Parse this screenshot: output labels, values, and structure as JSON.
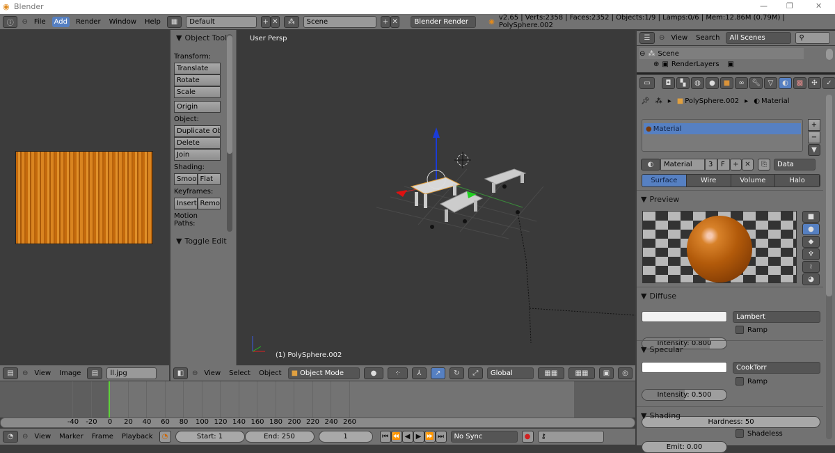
{
  "window": {
    "title": "Blender",
    "controls": [
      "—",
      "❐",
      "✕"
    ]
  },
  "topbar": {
    "menus": [
      "File",
      "Add",
      "Render",
      "Window",
      "Help"
    ],
    "active_menu": "Add",
    "layout": "Default",
    "scene": "Scene",
    "engine": "Blender Render",
    "stats": "v2.65 | Verts:2358 | Faces:2352 | Objects:1/9 | Lamps:0/6 | Mem:12.86M (0.79M) | PolySphere.002"
  },
  "image_editor": {
    "header": {
      "menus": [
        "View",
        "Image"
      ],
      "image": "ll.jpg"
    }
  },
  "tools": {
    "title": "Object Tools",
    "sections": [
      {
        "label": "Transform:",
        "buttons": [
          [
            "Translate"
          ],
          [
            "Rotate"
          ],
          [
            "Scale"
          ]
        ]
      },
      {
        "label": "",
        "buttons": [
          [
            "Origin"
          ]
        ]
      },
      {
        "label": "Object:",
        "buttons": [
          [
            "Duplicate Obj"
          ],
          [
            "Delete"
          ],
          [
            "Join"
          ]
        ]
      },
      {
        "label": "Shading:",
        "buttons": [
          [
            "Smoot",
            "Flat"
          ]
        ]
      },
      {
        "label": "Keyframes:",
        "buttons": [
          [
            "Insert",
            "Remo"
          ]
        ]
      },
      {
        "label": "Motion Paths:",
        "buttons": []
      }
    ],
    "toggle_edit": "Toggle Edit"
  },
  "viewport": {
    "label": "User Persp",
    "object": "(1) PolySphere.002",
    "header": {
      "menus": [
        "View",
        "Select",
        "Object"
      ],
      "mode": "Object Mode",
      "orientation": "Global"
    }
  },
  "outliner": {
    "menus": [
      "View",
      "Search"
    ],
    "filter": "All Scenes",
    "items": [
      "Scene",
      "RenderLayers"
    ]
  },
  "properties": {
    "breadcrumb": [
      "PolySphere.002",
      "Material"
    ],
    "slots": [
      "Material"
    ],
    "material_name": "Material",
    "users": "3",
    "fake": "F",
    "link": "Data",
    "tabs": [
      "Surface",
      "Wire",
      "Volume",
      "Halo"
    ],
    "active_tab": "Surface",
    "preview": {
      "title": "Preview"
    },
    "diffuse": {
      "title": "Diffuse",
      "shader": "Lambert",
      "intensity": "Intensity: 0.800",
      "intensity_value": 0.8,
      "ramp": "Ramp",
      "color": "#f2f2f2"
    },
    "specular": {
      "title": "Specular",
      "shader": "CookTorr",
      "intensity": "Intensity: 0.500",
      "intensity_value": 0.5,
      "ramp": "Ramp",
      "hardness": "Hardness: 50",
      "color": "#ffffff"
    },
    "shading": {
      "title": "Shading",
      "emit": "Emit: 0.00",
      "shadeless": "Shadeless"
    }
  },
  "timeline": {
    "ticks": [
      "-40",
      "-20",
      "0",
      "20",
      "40",
      "60",
      "80",
      "100",
      "120",
      "140",
      "160",
      "180",
      "200",
      "220",
      "240",
      "260"
    ],
    "current_frame": 0,
    "header": {
      "menus": [
        "View",
        "Marker",
        "Frame",
        "Playback"
      ],
      "start": "Start: 1",
      "end": "End: 250",
      "frame": "1",
      "sync": "No Sync"
    }
  },
  "colors": {
    "accent": "#5680c2",
    "x_axis": "#e01010",
    "y_axis": "#20d020",
    "z_axis": "#1a3bd8",
    "current_frame": "#5fd23a"
  }
}
